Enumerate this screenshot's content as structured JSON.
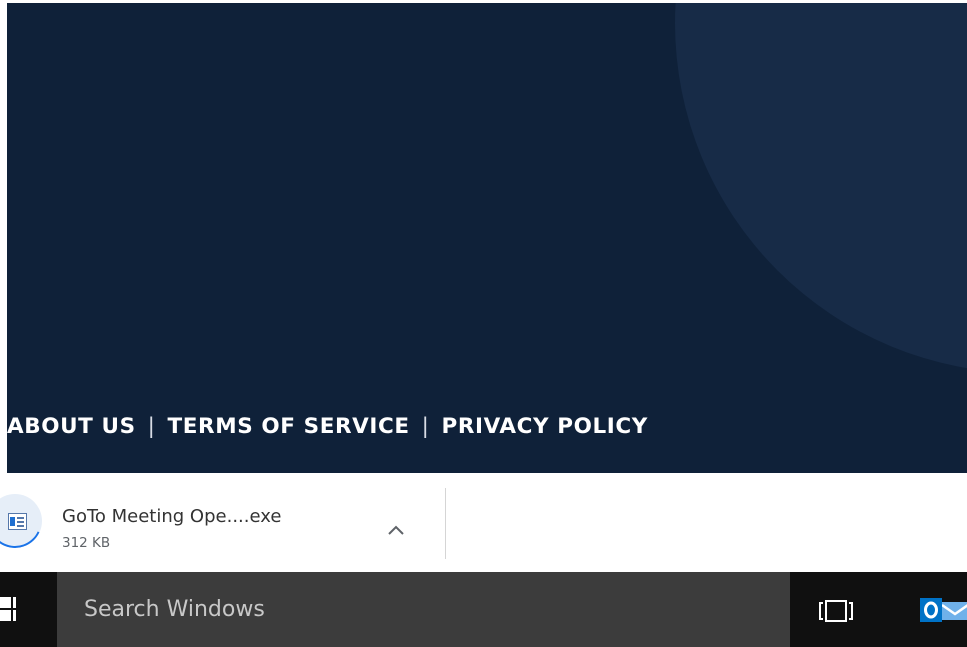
{
  "footer": {
    "links": [
      {
        "label": "ABOUT US"
      },
      {
        "label": "TERMS OF SERVICE"
      },
      {
        "label": "PRIVACY POLICY"
      }
    ],
    "separator": "|"
  },
  "download_bar": {
    "item": {
      "filename": "GoTo Meeting Ope....exe",
      "size": "312 KB",
      "icon": "installer-file-icon"
    }
  },
  "taskbar": {
    "search_placeholder": "Search Windows",
    "icons": [
      "windows-start-icon",
      "task-view-icon",
      "outlook-icon"
    ]
  },
  "colors": {
    "hero_background": "#0f2139",
    "hero_circle": "#172b47",
    "taskbar": "#101010",
    "search_box": "#3c3c3c",
    "outlook_blue": "#0072c6"
  }
}
